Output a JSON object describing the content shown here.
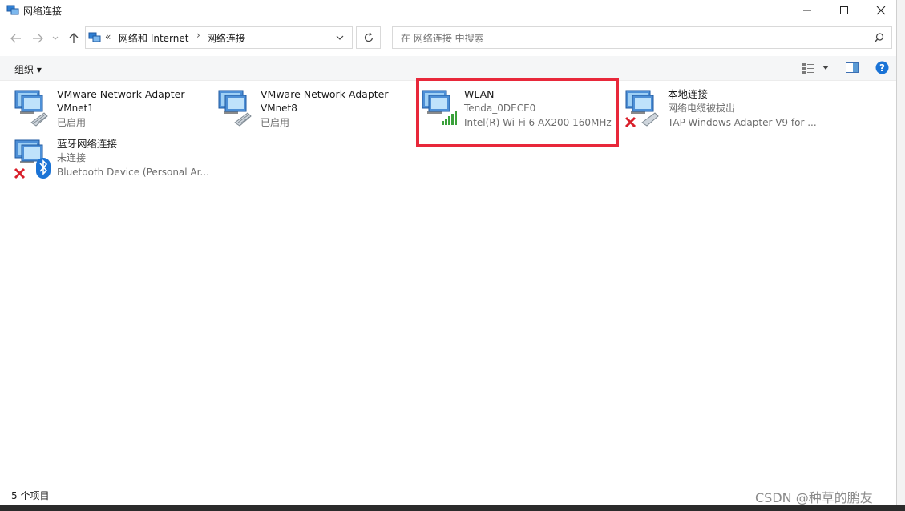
{
  "window": {
    "title": "网络连接"
  },
  "address": {
    "overflow": "«",
    "crumbs": [
      "网络和 Internet",
      "网络连接"
    ],
    "search_placeholder": "在 网络连接 中搜索"
  },
  "toolbar": {
    "organize_label": "组织 ▾"
  },
  "items": [
    {
      "name": "VMware Network Adapter",
      "line2": "VMnet1",
      "line3": "已启用",
      "status": "enabled"
    },
    {
      "name": "VMware Network Adapter",
      "line2": "VMnet8",
      "line3": "已启用",
      "status": "enabled"
    },
    {
      "name": "WLAN",
      "line2": "Tenda_0DECE0",
      "line3": "Intel(R) Wi-Fi 6 AX200 160MHz",
      "status": "wifi"
    },
    {
      "name": "本地连接",
      "line2": "网络电缆被拔出",
      "line3": "TAP-Windows Adapter V9 for ...",
      "status": "disconnected"
    },
    {
      "name": "蓝牙网络连接",
      "line2": "未连接",
      "line3": "Bluetooth Device (Personal Ar...",
      "status": "bluetooth-disconnected"
    }
  ],
  "status": {
    "item_count": "5 个项目"
  },
  "watermark": "CSDN @种草的鹏友",
  "colors": {
    "highlight": "#e8283a",
    "accent": "#0078d7",
    "error": "#d9202b",
    "signal": "#3aa13a"
  }
}
